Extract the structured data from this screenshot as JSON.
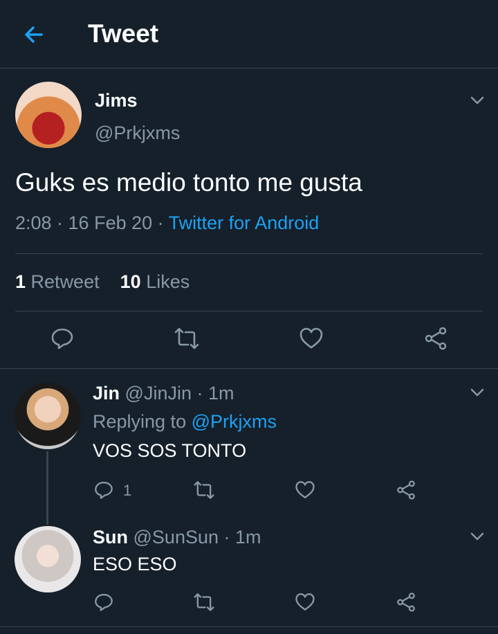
{
  "header": {
    "title": "Tweet"
  },
  "tweet": {
    "author_name": "Jims",
    "author_handle": "@Prkjxms",
    "text": "Guks es medio tonto me gusta",
    "time": "2:08 · 16 Feb 20 · ",
    "source": "Twitter for Android",
    "retweet_count": "1",
    "retweet_label": "Retweet",
    "like_count": "10",
    "like_label": "Likes"
  },
  "replies": [
    {
      "name": "Jin",
      "handle_time": "@JinJin · 1m",
      "replying_label": "Replying to ",
      "replying_to": "@Prkjxms",
      "text": "VOS SOS TONTO",
      "reply_count": "1"
    },
    {
      "name": "Sun",
      "handle_time": "@SunSun · 1m",
      "text": "ESO ESO"
    }
  ],
  "colors": {
    "background": "#15202b",
    "accent": "#1da1f2",
    "secondary": "#8899a6",
    "divider": "#38444d"
  }
}
